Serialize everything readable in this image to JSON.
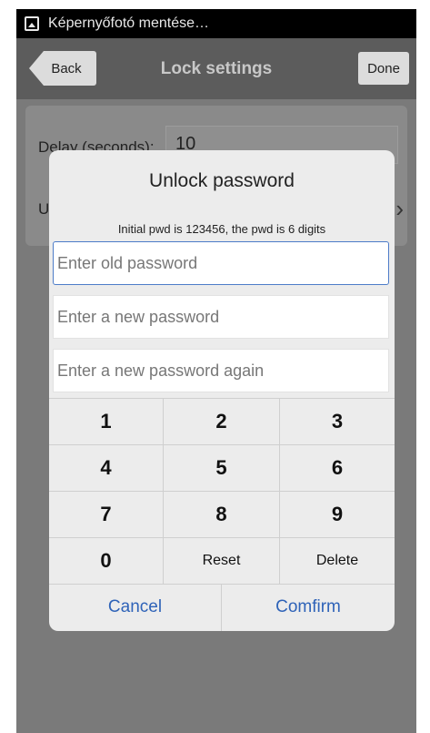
{
  "status_bar": {
    "text": "Képernyőfotó mentése…",
    "icon": "image-icon"
  },
  "header": {
    "back_label": "Back",
    "title": "Lock settings",
    "done_label": "Done"
  },
  "settings": {
    "delay_label": "Delay (seconds):",
    "delay_value": "10",
    "unlock_label": "U",
    "arrow": "›"
  },
  "dialog": {
    "title": "Unlock password",
    "hint": "Initial pwd is 123456, the pwd is 6 digits",
    "old_placeholder": "Enter old password",
    "new_placeholder": "Enter a new password",
    "again_placeholder": "Enter a new password again",
    "keys": [
      [
        "1",
        "2",
        "3"
      ],
      [
        "4",
        "5",
        "6"
      ],
      [
        "7",
        "8",
        "9"
      ],
      [
        "0",
        "Reset",
        "Delete"
      ]
    ],
    "cancel_label": "Cancel",
    "confirm_label": "Comfirm"
  },
  "colors": {
    "accent": "#2f63b8",
    "focus_border": "#4d7cc8",
    "title_bar": "#5c5c5c"
  }
}
